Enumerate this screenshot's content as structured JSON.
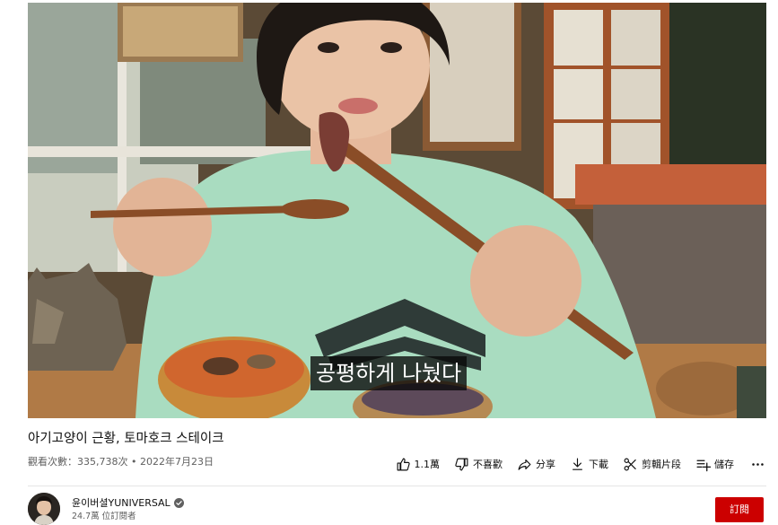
{
  "video": {
    "caption": "공평하게 나눴다"
  },
  "title": "아기고양이 근황, 토마호크 스테이크",
  "meta": {
    "views": "觀看次數：335,738次",
    "separator": " • ",
    "date": "2022年7月23日"
  },
  "actions": {
    "like": {
      "label": "1.1萬",
      "icon": "thumbs-up-icon"
    },
    "dislike": {
      "label": "不喜歡",
      "icon": "thumbs-down-icon"
    },
    "share": {
      "label": "分享",
      "icon": "share-icon"
    },
    "download": {
      "label": "下載",
      "icon": "download-icon"
    },
    "clip": {
      "label": "剪輯片段",
      "icon": "scissors-icon"
    },
    "save": {
      "label": "儲存",
      "icon": "playlist-add-icon"
    },
    "more": {
      "icon": "more-horizontal-icon"
    }
  },
  "channel": {
    "name": "윤이버셜YUNIVERSAL",
    "verified": true,
    "subscribers": "24.7萬 位訂閱者",
    "subscribe_label": "訂閱",
    "subscribe_color": "#cc0000"
  }
}
